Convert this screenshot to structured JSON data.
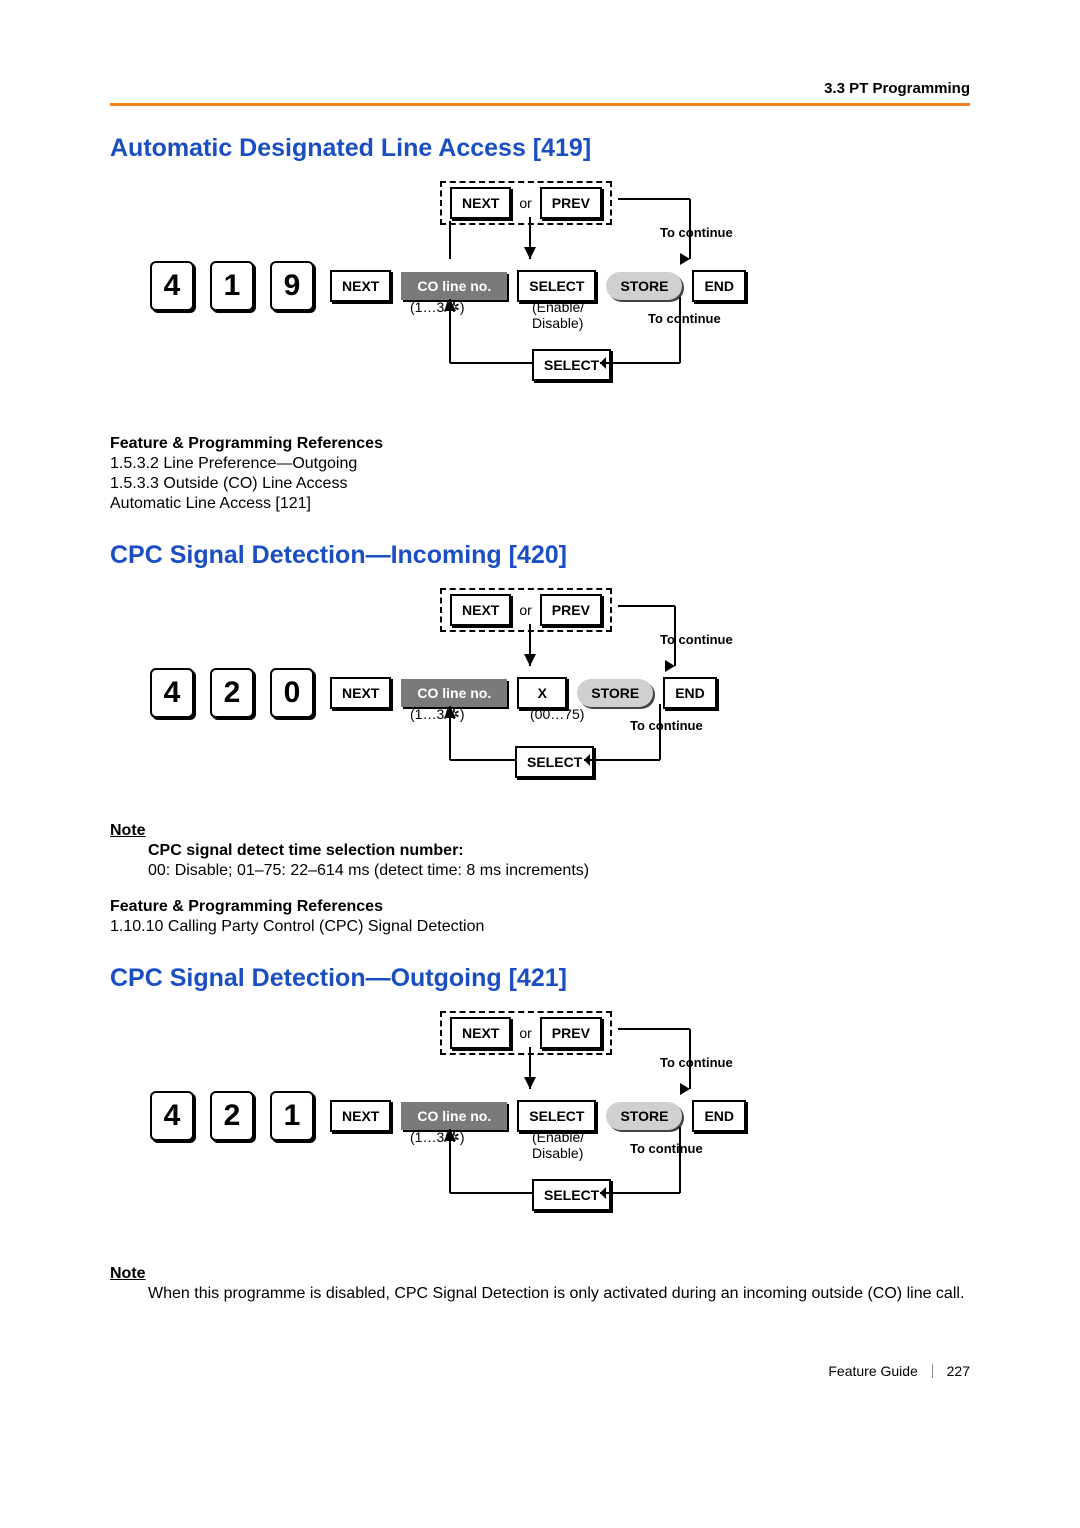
{
  "header": {
    "section_ref": "3.3 PT Programming"
  },
  "footer": {
    "guide": "Feature Guide",
    "page": "227"
  },
  "labels": {
    "next": "NEXT",
    "prev": "PREV",
    "or": "or",
    "co_line": "CO line no.",
    "select": "SELECT",
    "store": "STORE",
    "end": "END",
    "to_continue": "To continue",
    "range_13star": "(1…3/✲)",
    "enable_disable": "(Enable/\nDisable)",
    "x_input": "X",
    "range_0075": "(00…75)"
  },
  "sec419": {
    "title": "Automatic Designated Line Access [419]",
    "digits": [
      "4",
      "1",
      "9"
    ],
    "refs_head": "Feature & Programming References",
    "refs": [
      "1.5.3.2 Line Preference—Outgoing",
      "1.5.3.3 Outside (CO) Line Access",
      "Automatic Line Access [121]"
    ]
  },
  "sec420": {
    "title": "CPC Signal Detection—Incoming [420]",
    "digits": [
      "4",
      "2",
      "0"
    ],
    "note_head": "Note",
    "note_bold": "CPC signal detect time selection number:",
    "note_text": "00: Disable; 01–75: 22–614 ms (detect time: 8 ms increments)",
    "refs_head": "Feature & Programming References",
    "refs": [
      "1.10.10 Calling Party Control (CPC) Signal Detection"
    ]
  },
  "sec421": {
    "title": "CPC Signal Detection—Outgoing [421]",
    "digits": [
      "4",
      "2",
      "1"
    ],
    "note_head": "Note",
    "note_text": "When this programme is disabled, CPC Signal Detection is only activated during an incoming outside (CO) line call."
  }
}
